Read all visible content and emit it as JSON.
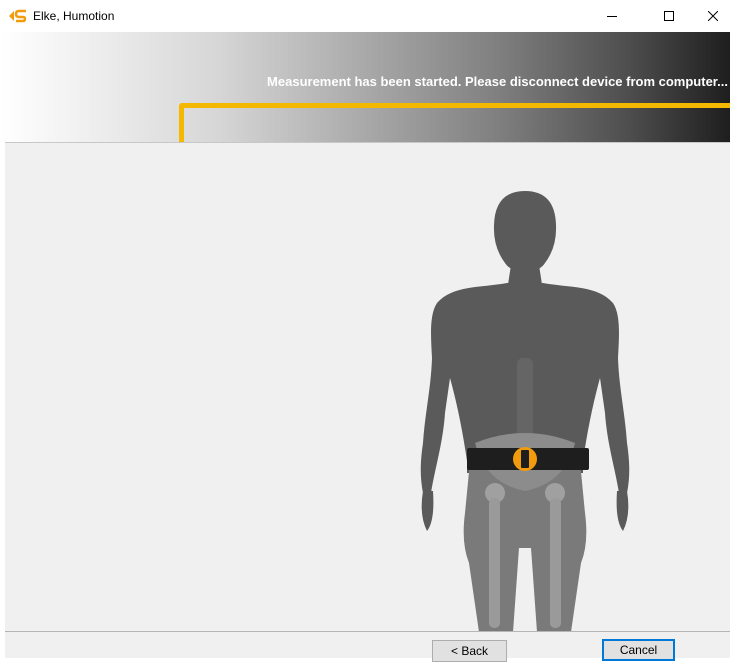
{
  "window": {
    "title": "Elke, Humotion",
    "controls": [
      "minimize",
      "maximize",
      "close"
    ]
  },
  "header": {
    "status_message": "Measurement has been started. Please disconnect device from computer..."
  },
  "illustration": {
    "subject": "human-back-view-with-sensor-belt"
  },
  "footer": {
    "back_label": "< Back",
    "cancel_label": "Cancel"
  },
  "colors": {
    "highlight": "#f5b800",
    "sensor": "#f29b0c",
    "figure": "#5a5a5a"
  }
}
